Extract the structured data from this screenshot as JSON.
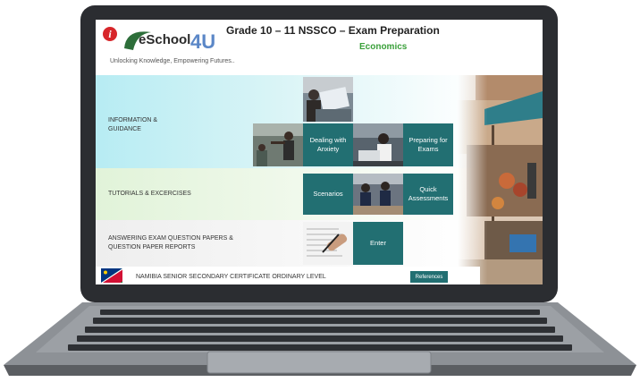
{
  "header": {
    "info_icon": "i",
    "logo_text": "eSchool",
    "logo_accent": "4U",
    "tagline": "Unlocking Knowledge, Empowering Futures..",
    "title": "Grade 10 – 11  NSSCO – Exam Preparation",
    "subject": "Economics"
  },
  "sections": {
    "information": {
      "label_line1": "INFORMATION &",
      "label_line2": "GUIDANCE"
    },
    "tutorials": {
      "label": "TUTORIALS & EXCERCISES"
    },
    "answering": {
      "label_line1": "ANSWERING EXAM QUESTION PAPERS &",
      "label_line2": "QUESTION PAPER REPORTS"
    }
  },
  "tiles": {
    "anxiety_line1": "Dealing with",
    "anxiety_line2": "Anxiety",
    "preparing_line1": "Preparing for",
    "preparing_line2": "Exams",
    "scenarios": "Scenarios",
    "quick_line1": "Quick",
    "quick_line2": "Assessments",
    "enter": "Enter"
  },
  "footer": {
    "certificate": "NAMIBIA SENIOR SECONDARY CERTIFICATE ORDINARY LEVEL",
    "references": "References"
  },
  "colors": {
    "tile": "#226f72",
    "subject": "#3aa03a",
    "info_icon": "#d7262a",
    "logo_accent": "#5b87c7"
  }
}
